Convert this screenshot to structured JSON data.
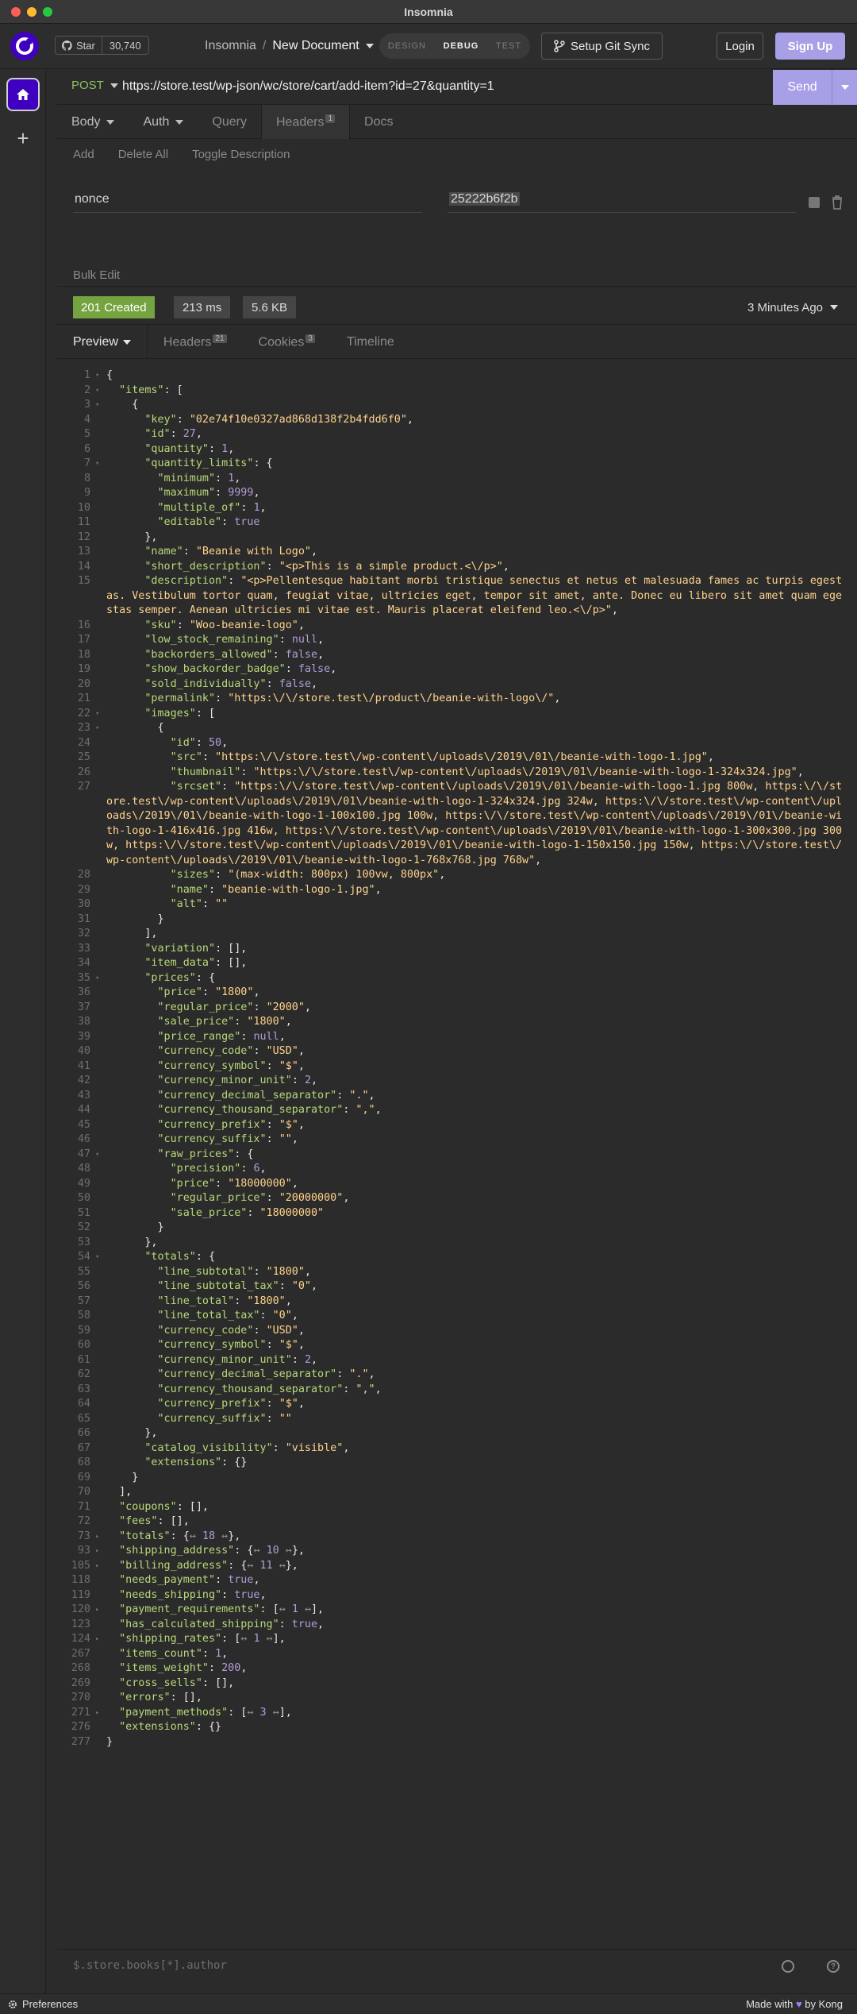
{
  "window": {
    "title": "Insomnia"
  },
  "header": {
    "star_label": "Star",
    "star_count": "30,740",
    "project": "Insomnia",
    "separator": "/",
    "document": "New Document",
    "modes": [
      "DESIGN",
      "DEBUG",
      "TEST"
    ],
    "active_mode": "DEBUG",
    "git_sync": "Setup Git Sync",
    "login": "Login",
    "signup": "Sign Up"
  },
  "request": {
    "method": "POST",
    "url": "https://store.test/wp-json/wc/store/cart/add-item?id=27&quantity=1",
    "send": "Send",
    "tabs": [
      {
        "label": "Body"
      },
      {
        "label": "Auth"
      },
      {
        "label": "Query"
      },
      {
        "label": "Headers",
        "badge": "1"
      },
      {
        "label": "Docs"
      }
    ],
    "header_tools": [
      "Add",
      "Delete All",
      "Toggle Description"
    ],
    "headers": [
      {
        "name": "nonce",
        "value": "25222b6f2b"
      }
    ],
    "bulk_edit": "Bulk Edit"
  },
  "response": {
    "status": "201 Created",
    "time": "213 ms",
    "size": "5.6 KB",
    "ago": "3 Minutes Ago",
    "tabs": [
      {
        "label": "Preview"
      },
      {
        "label": "Headers",
        "badge": "21"
      },
      {
        "label": "Cookies",
        "badge": "3"
      },
      {
        "label": "Timeline"
      }
    ],
    "filter_placeholder": "$.store.books[*].author"
  },
  "body_lines": [
    {
      "n": "1",
      "f": "▾",
      "t": "{"
    },
    {
      "n": "2",
      "f": "▾",
      "t": "  \"items\": ["
    },
    {
      "n": "3",
      "f": "▾",
      "t": "    {"
    },
    {
      "n": "4",
      "t": "      \"key\": \"02e74f10e0327ad868d138f2b4fdd6f0\","
    },
    {
      "n": "5",
      "t": "      \"id\": 27,"
    },
    {
      "n": "6",
      "t": "      \"quantity\": 1,"
    },
    {
      "n": "7",
      "f": "▾",
      "t": "      \"quantity_limits\": {"
    },
    {
      "n": "8",
      "t": "        \"minimum\": 1,"
    },
    {
      "n": "9",
      "t": "        \"maximum\": 9999,"
    },
    {
      "n": "10",
      "t": "        \"multiple_of\": 1,"
    },
    {
      "n": "11",
      "t": "        \"editable\": true"
    },
    {
      "n": "12",
      "t": "      },"
    },
    {
      "n": "13",
      "t": "      \"name\": \"Beanie with Logo\","
    },
    {
      "n": "14",
      "t": "      \"short_description\": \"<p>This is a simple product.<\\/p>\","
    },
    {
      "n": "15",
      "t": "      \"description\": \"<p>Pellentesque habitant morbi tristique senectus et netus et malesuada fames ac turpis egestas. Vestibulum tortor quam, feugiat vitae, ultricies eget, tempor sit amet, ante. Donec eu libero sit amet quam egestas semper. Aenean ultricies mi vitae est. Mauris placerat eleifend leo.<\\/p>\","
    },
    {
      "n": "16",
      "t": "      \"sku\": \"Woo-beanie-logo\","
    },
    {
      "n": "17",
      "t": "      \"low_stock_remaining\": null,"
    },
    {
      "n": "18",
      "t": "      \"backorders_allowed\": false,"
    },
    {
      "n": "19",
      "t": "      \"show_backorder_badge\": false,"
    },
    {
      "n": "20",
      "t": "      \"sold_individually\": false,"
    },
    {
      "n": "21",
      "t": "      \"permalink\": \"https:\\/\\/store.test\\/product\\/beanie-with-logo\\/\","
    },
    {
      "n": "22",
      "f": "▾",
      "t": "      \"images\": ["
    },
    {
      "n": "23",
      "f": "▾",
      "t": "        {"
    },
    {
      "n": "24",
      "t": "          \"id\": 50,"
    },
    {
      "n": "25",
      "t": "          \"src\": \"https:\\/\\/store.test\\/wp-content\\/uploads\\/2019\\/01\\/beanie-with-logo-1.jpg\","
    },
    {
      "n": "26",
      "t": "          \"thumbnail\": \"https:\\/\\/store.test\\/wp-content\\/uploads\\/2019\\/01\\/beanie-with-logo-1-324x324.jpg\","
    },
    {
      "n": "27",
      "t": "          \"srcset\": \"https:\\/\\/store.test\\/wp-content\\/uploads\\/2019\\/01\\/beanie-with-logo-1.jpg 800w, https:\\/\\/store.test\\/wp-content\\/uploads\\/2019\\/01\\/beanie-with-logo-1-324x324.jpg 324w, https:\\/\\/store.test\\/wp-content\\/uploads\\/2019\\/01\\/beanie-with-logo-1-100x100.jpg 100w, https:\\/\\/store.test\\/wp-content\\/uploads\\/2019\\/01\\/beanie-with-logo-1-416x416.jpg 416w, https:\\/\\/store.test\\/wp-content\\/uploads\\/2019\\/01\\/beanie-with-logo-1-300x300.jpg 300w, https:\\/\\/store.test\\/wp-content\\/uploads\\/2019\\/01\\/beanie-with-logo-1-150x150.jpg 150w, https:\\/\\/store.test\\/wp-content\\/uploads\\/2019\\/01\\/beanie-with-logo-1-768x768.jpg 768w\","
    },
    {
      "n": "28",
      "t": "          \"sizes\": \"(max-width: 800px) 100vw, 800px\","
    },
    {
      "n": "29",
      "t": "          \"name\": \"beanie-with-logo-1.jpg\","
    },
    {
      "n": "30",
      "t": "          \"alt\": \"\""
    },
    {
      "n": "31",
      "t": "        }"
    },
    {
      "n": "32",
      "t": "      ],"
    },
    {
      "n": "33",
      "t": "      \"variation\": [],"
    },
    {
      "n": "34",
      "t": "      \"item_data\": [],"
    },
    {
      "n": "35",
      "f": "▾",
      "t": "      \"prices\": {"
    },
    {
      "n": "36",
      "t": "        \"price\": \"1800\","
    },
    {
      "n": "37",
      "t": "        \"regular_price\": \"2000\","
    },
    {
      "n": "38",
      "t": "        \"sale_price\": \"1800\","
    },
    {
      "n": "39",
      "t": "        \"price_range\": null,"
    },
    {
      "n": "40",
      "t": "        \"currency_code\": \"USD\","
    },
    {
      "n": "41",
      "t": "        \"currency_symbol\": \"$\","
    },
    {
      "n": "42",
      "t": "        \"currency_minor_unit\": 2,"
    },
    {
      "n": "43",
      "t": "        \"currency_decimal_separator\": \".\","
    },
    {
      "n": "44",
      "t": "        \"currency_thousand_separator\": \",\","
    },
    {
      "n": "45",
      "t": "        \"currency_prefix\": \"$\","
    },
    {
      "n": "46",
      "t": "        \"currency_suffix\": \"\","
    },
    {
      "n": "47",
      "f": "▾",
      "t": "        \"raw_prices\": {"
    },
    {
      "n": "48",
      "t": "          \"precision\": 6,"
    },
    {
      "n": "49",
      "t": "          \"price\": \"18000000\","
    },
    {
      "n": "50",
      "t": "          \"regular_price\": \"20000000\","
    },
    {
      "n": "51",
      "t": "          \"sale_price\": \"18000000\""
    },
    {
      "n": "52",
      "t": "        }"
    },
    {
      "n": "53",
      "t": "      },"
    },
    {
      "n": "54",
      "f": "▾",
      "t": "      \"totals\": {"
    },
    {
      "n": "55",
      "t": "        \"line_subtotal\": \"1800\","
    },
    {
      "n": "56",
      "t": "        \"line_subtotal_tax\": \"0\","
    },
    {
      "n": "57",
      "t": "        \"line_total\": \"1800\","
    },
    {
      "n": "58",
      "t": "        \"line_total_tax\": \"0\","
    },
    {
      "n": "59",
      "t": "        \"currency_code\": \"USD\","
    },
    {
      "n": "60",
      "t": "        \"currency_symbol\": \"$\","
    },
    {
      "n": "61",
      "t": "        \"currency_minor_unit\": 2,"
    },
    {
      "n": "62",
      "t": "        \"currency_decimal_separator\": \".\","
    },
    {
      "n": "63",
      "t": "        \"currency_thousand_separator\": \",\","
    },
    {
      "n": "64",
      "t": "        \"currency_prefix\": \"$\","
    },
    {
      "n": "65",
      "t": "        \"currency_suffix\": \"\""
    },
    {
      "n": "66",
      "t": "      },"
    },
    {
      "n": "67",
      "t": "      \"catalog_visibility\": \"visible\","
    },
    {
      "n": "68",
      "t": "      \"extensions\": {}"
    },
    {
      "n": "69",
      "t": "    }"
    },
    {
      "n": "70",
      "t": "  ],"
    },
    {
      "n": "71",
      "t": "  \"coupons\": [],"
    },
    {
      "n": "72",
      "t": "  \"fees\": [],"
    },
    {
      "n": "73",
      "f": "▸",
      "t": "  \"totals\": {↔ 18 ↔},"
    },
    {
      "n": "93",
      "f": "▸",
      "t": "  \"shipping_address\": {↔ 10 ↔},"
    },
    {
      "n": "105",
      "f": "▸",
      "t": "  \"billing_address\": {↔ 11 ↔},"
    },
    {
      "n": "118",
      "t": "  \"needs_payment\": true,"
    },
    {
      "n": "119",
      "t": "  \"needs_shipping\": true,"
    },
    {
      "n": "120",
      "f": "▸",
      "t": "  \"payment_requirements\": [↔ 1 ↔],"
    },
    {
      "n": "123",
      "t": "  \"has_calculated_shipping\": true,"
    },
    {
      "n": "124",
      "f": "▸",
      "t": "  \"shipping_rates\": [↔ 1 ↔],"
    },
    {
      "n": "267",
      "t": "  \"items_count\": 1,"
    },
    {
      "n": "268",
      "t": "  \"items_weight\": 200,"
    },
    {
      "n": "269",
      "t": "  \"cross_sells\": [],"
    },
    {
      "n": "270",
      "t": "  \"errors\": [],"
    },
    {
      "n": "271",
      "f": "▸",
      "t": "  \"payment_methods\": [↔ 3 ↔],"
    },
    {
      "n": "276",
      "t": "  \"extensions\": {}"
    },
    {
      "n": "277",
      "t": "}"
    }
  ],
  "footer": {
    "preferences": "Preferences",
    "made_with": "Made with",
    "by": "by Kong"
  },
  "colors": {
    "accent": "#4000bf",
    "send": "#a7a0e7",
    "status_ok": "#75a33f",
    "method": "#8fc162"
  }
}
